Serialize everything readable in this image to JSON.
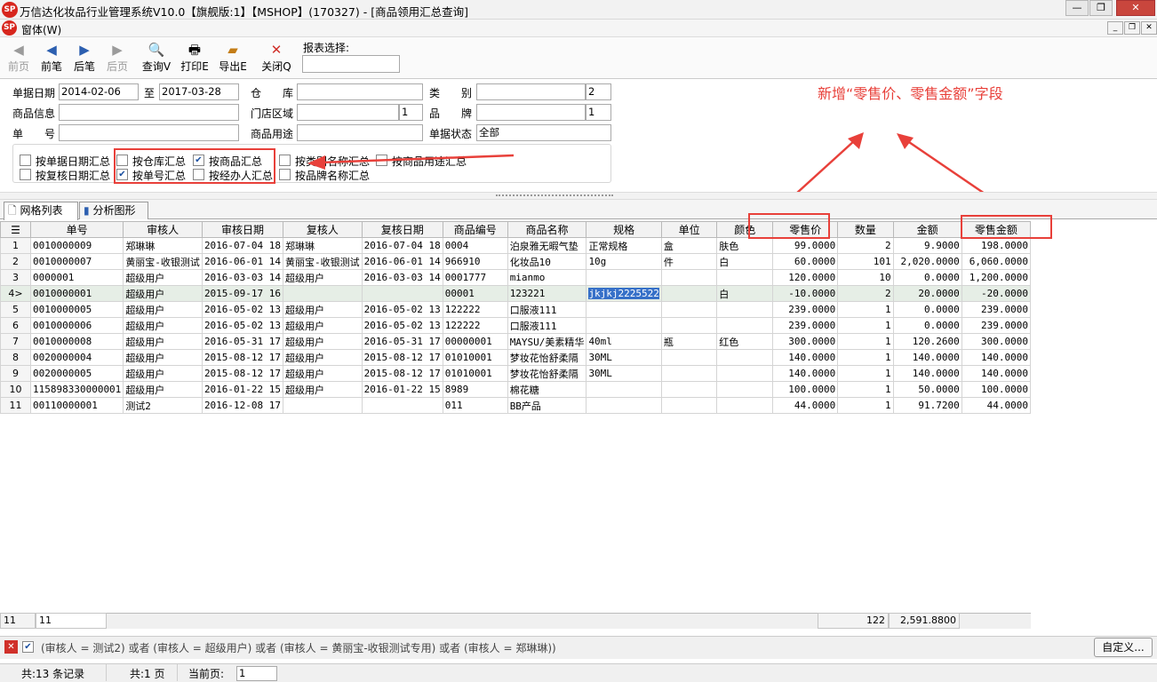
{
  "window": {
    "title": "万信达化妆品行业管理系统V10.0【旗舰版:1】【MSHOP】(170327) - [商品领用汇总查询]",
    "logo": "SP"
  },
  "menu": {
    "window": "窗体(W)"
  },
  "toolbar": {
    "prev_page": "前页",
    "prev": "前笔",
    "next": "后笔",
    "next_page": "后页",
    "query": "查询V",
    "print": "打印E",
    "export": "导出E",
    "close": "关闭Q",
    "report_select_label": "报表选择:",
    "report_select_value": ""
  },
  "filters": {
    "date_label": "单据日期",
    "date_from": "2014-02-06",
    "to_label": "至",
    "date_to": "2017-03-28",
    "warehouse_label": "仓　　库",
    "warehouse": "",
    "category_label": "类　　别",
    "category": "",
    "category_level": "2",
    "goods_info_label": "商品信息",
    "goods_info": "",
    "store_area_label": "门店区域",
    "store_area": "",
    "store_area_level": "1",
    "brand_label": "品　　牌",
    "brand": "",
    "brand_level": "1",
    "doc_no_label": "单　　号",
    "doc_no": "",
    "usage_label": "商品用途",
    "usage": "",
    "status_label": "单据状态",
    "status": "全部"
  },
  "group": [
    {
      "label": "按单据日期汇总",
      "checked": false
    },
    {
      "label": "按复核日期汇总",
      "checked": false
    },
    {
      "label": "按仓库汇总",
      "checked": false
    },
    {
      "label": "按单号汇总",
      "checked": true
    },
    {
      "label": "按商品汇总",
      "checked": true
    },
    {
      "label": "按经办人汇总",
      "checked": false
    },
    {
      "label": "按类别名称汇总",
      "checked": false
    },
    {
      "label": "按品牌名称汇总",
      "checked": false
    },
    {
      "label": "按商品用途汇总",
      "checked": false
    }
  ],
  "annotation": "新增“零售价、零售金额”字段",
  "tabs": {
    "grid": "网格列表",
    "chart": "分析图形"
  },
  "columns": [
    "单号",
    "审核人",
    "审核日期",
    "复核人",
    "复核日期",
    "商品编号",
    "商品名称",
    "规格",
    "单位",
    "颜色",
    "零售价",
    "数量",
    "金额",
    "零售金额"
  ],
  "rows": [
    {
      "rn": "1",
      "c": [
        "0010000009",
        "郑琳琳",
        "2016-07-04 18",
        "郑琳琳",
        "2016-07-04 18",
        "0004",
        "泊泉雅无暇气垫",
        "正常规格",
        "盒",
        "肤色",
        "99.0000",
        "2",
        "9.9000",
        "198.0000"
      ]
    },
    {
      "rn": "2",
      "c": [
        "0010000007",
        "黄丽宝-收银测试",
        "2016-06-01 14",
        "黄丽宝-收银测试",
        "2016-06-01 14",
        "966910",
        "化妆品10",
        "10g",
        "件",
        "白",
        "60.0000",
        "101",
        "2,020.0000",
        "6,060.0000"
      ]
    },
    {
      "rn": "3",
      "c": [
        "0000001",
        "超级用户",
        "2016-03-03 14",
        "超级用户",
        "2016-03-03 14",
        "0001777",
        "mianmo",
        "",
        "",
        "",
        "120.0000",
        "10",
        "0.0000",
        "1,200.0000"
      ]
    },
    {
      "rn": "4",
      "c": [
        "0010000001",
        "超级用户",
        "2015-09-17 16",
        "",
        "",
        "00001",
        "123221",
        "jkjkj2225522",
        "",
        "白",
        "-10.0000",
        "2",
        "20.0000",
        "-20.0000"
      ]
    },
    {
      "rn": "5",
      "c": [
        "0010000005",
        "超级用户",
        "2016-05-02 13",
        "超级用户",
        "2016-05-02 13",
        "122222",
        "口服液111",
        "",
        "",
        "",
        "239.0000",
        "1",
        "0.0000",
        "239.0000"
      ]
    },
    {
      "rn": "6",
      "c": [
        "0010000006",
        "超级用户",
        "2016-05-02 13",
        "超级用户",
        "2016-05-02 13",
        "122222",
        "口服液111",
        "",
        "",
        "",
        "239.0000",
        "1",
        "0.0000",
        "239.0000"
      ]
    },
    {
      "rn": "7",
      "c": [
        "0010000008",
        "超级用户",
        "2016-05-31 17",
        "超级用户",
        "2016-05-31 17",
        "00000001",
        "MAYSU/美素精华",
        "40ml",
        "瓶",
        "红色",
        "300.0000",
        "1",
        "120.2600",
        "300.0000"
      ]
    },
    {
      "rn": "8",
      "c": [
        "0020000004",
        "超级用户",
        "2015-08-12 17",
        "超级用户",
        "2015-08-12 17",
        "01010001",
        "梦妆花怡舒柔隔",
        "30ML",
        "",
        "",
        "140.0000",
        "1",
        "140.0000",
        "140.0000"
      ]
    },
    {
      "rn": "9",
      "c": [
        "0020000005",
        "超级用户",
        "2015-08-12 17",
        "超级用户",
        "2015-08-12 17",
        "01010001",
        "梦妆花怡舒柔隔",
        "30ML",
        "",
        "",
        "140.0000",
        "1",
        "140.0000",
        "140.0000"
      ]
    },
    {
      "rn": "10",
      "c": [
        "115898330000001",
        "超级用户",
        "2016-01-22 15",
        "超级用户",
        "2016-01-22 15",
        "8989",
        "棉花糖",
        "",
        "",
        "",
        "100.0000",
        "1",
        "50.0000",
        "100.0000"
      ]
    },
    {
      "rn": "11",
      "c": [
        "00110000001",
        "测试2",
        "2016-12-08 17",
        "",
        "",
        "011",
        "BB产品",
        "",
        "",
        "",
        "44.0000",
        "1",
        "91.7200",
        "44.0000"
      ]
    }
  ],
  "footer": {
    "rowcount_a": "11",
    "rowcount_b": "11",
    "qty_total": "122",
    "amount_total": "2,591.8800"
  },
  "filter_expr": "(审核人 = 测试2) 或者 (审核人 = 超级用户) 或者 (审核人 = 黄丽宝-收银测试专用) 或者 (审核人 = 郑琳琳))",
  "customize": "自定义...",
  "status": {
    "records": "共:13 条记录",
    "pages": "共:1 页",
    "current_label": "当前页:",
    "current_page": "1"
  }
}
